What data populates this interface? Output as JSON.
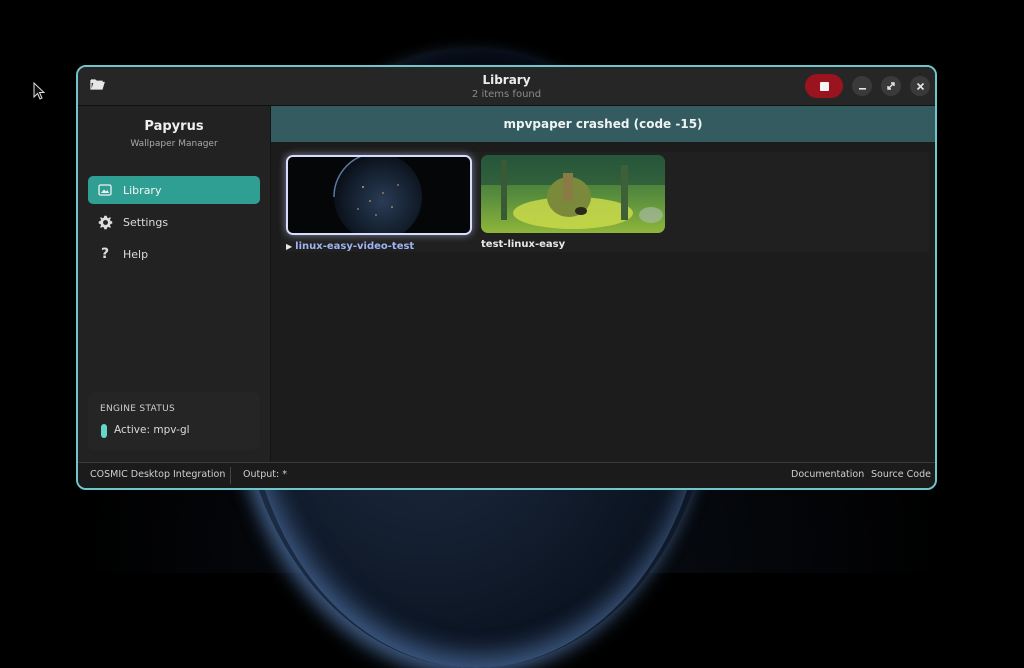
{
  "titlebar": {
    "title": "Library",
    "subtitle": "2 items found"
  },
  "sidebar": {
    "app_name": "Papyrus",
    "app_subtitle": "Wallpaper Manager",
    "items": [
      {
        "label": "Library",
        "icon": "image-icon",
        "active": true
      },
      {
        "label": "Settings",
        "icon": "gear-icon",
        "active": false
      },
      {
        "label": "Help",
        "icon": "question-icon",
        "active": false
      }
    ],
    "engine_status": {
      "title": "ENGINE STATUS",
      "value": "Active: mpv-gl"
    }
  },
  "banner": {
    "message": "mpvpaper crashed (code -15)"
  },
  "library": {
    "items": [
      {
        "label": "linux-easy-video-test",
        "selected": true,
        "playing_icon": "play-icon"
      },
      {
        "label": "test-linux-easy",
        "selected": false
      }
    ]
  },
  "footer": {
    "integration": "COSMIC Desktop Integration",
    "output": "Output: *",
    "documentation": "Documentation",
    "source_code": "Source Code"
  },
  "colors": {
    "accent": "#2f9f93",
    "window_border": "#6fc7cc",
    "banner": "#345b5f",
    "stop_button": "#9a1420",
    "status_indicator": "#67d6c8"
  }
}
